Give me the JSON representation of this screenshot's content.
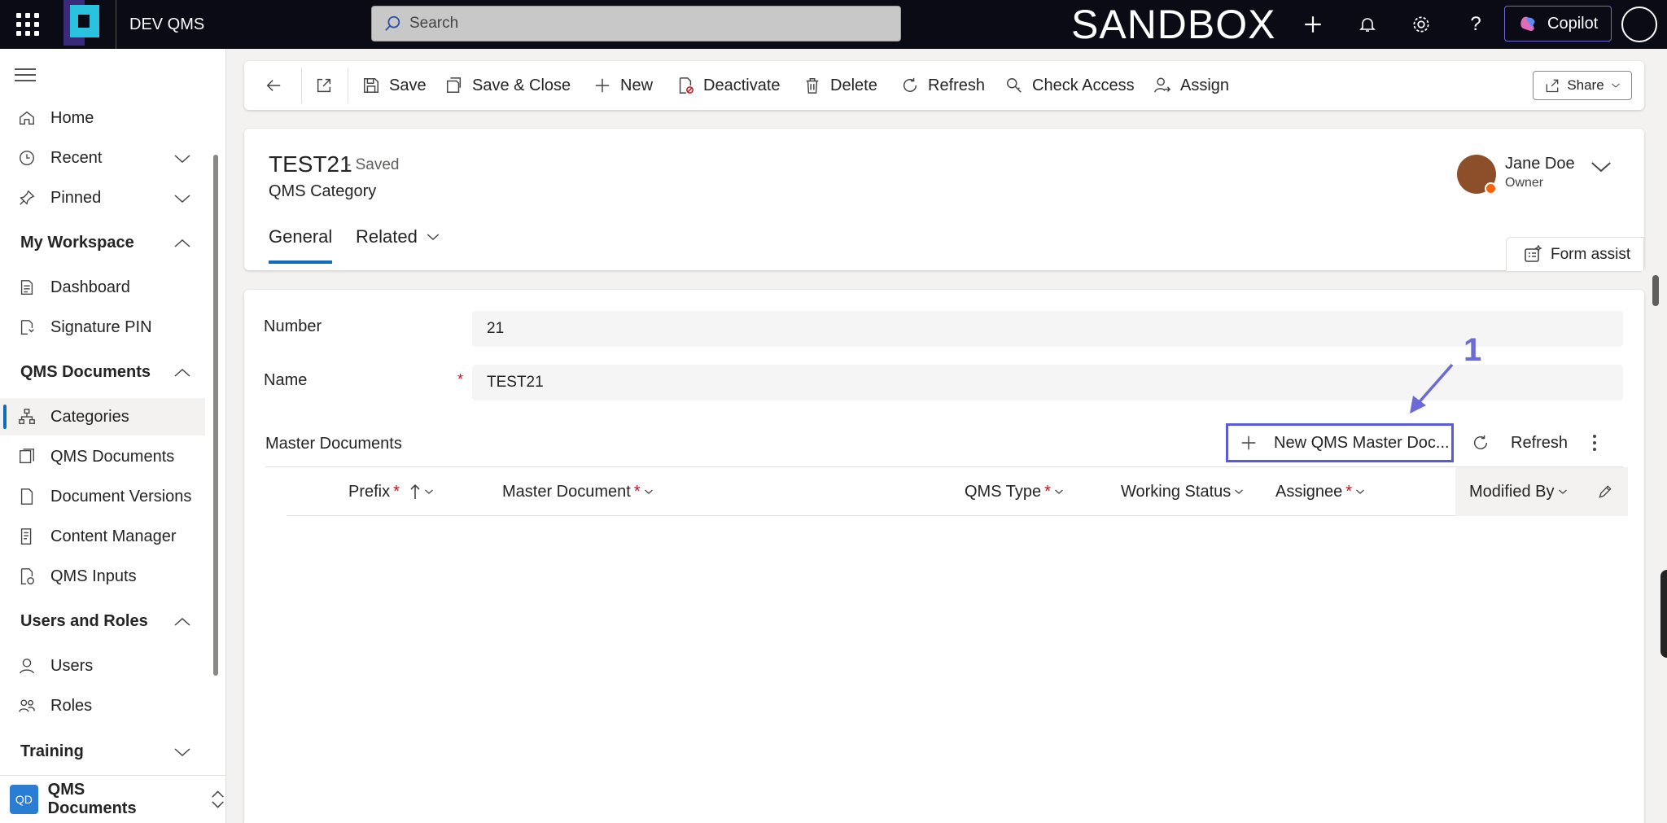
{
  "topbar": {
    "app_title": "DEV QMS",
    "search_placeholder": "Search",
    "environment_label": "SANDBOX",
    "copilot_label": "Copilot"
  },
  "sidebar": {
    "items": {
      "home": "Home",
      "recent": "Recent",
      "pinned": "Pinned",
      "dashboard": "Dashboard",
      "signature_pin": "Signature PIN",
      "categories": "Categories",
      "qms_documents": "QMS Documents",
      "document_versions": "Document Versions",
      "content_manager": "Content Manager",
      "qms_inputs": "QMS Inputs",
      "users": "Users",
      "roles": "Roles"
    },
    "groups": {
      "my_workspace": "My Workspace",
      "qms_documents": "QMS Documents",
      "users_and_roles": "Users and Roles",
      "training": "Training"
    },
    "area": {
      "badge": "QD",
      "label": "QMS Documents"
    }
  },
  "commandbar": {
    "save": "Save",
    "save_close": "Save & Close",
    "new": "New",
    "deactivate": "Deactivate",
    "delete": "Delete",
    "refresh": "Refresh",
    "check_access": "Check Access",
    "assign": "Assign",
    "share": "Share"
  },
  "record": {
    "title": "TEST21",
    "saved_status": "- Saved",
    "entity": "QMS Category",
    "tabs": {
      "general": "General",
      "related": "Related"
    },
    "owner": {
      "name": "Jane Doe",
      "role": "Owner"
    },
    "form_assist": "Form assist"
  },
  "form": {
    "number_label": "Number",
    "number_value": "21",
    "name_label": "Name",
    "name_value": "TEST21",
    "required_mark": "*"
  },
  "subgrid": {
    "title": "Master Documents",
    "new_button": "New QMS Master Doc...",
    "refresh": "Refresh",
    "columns": {
      "prefix": "Prefix",
      "master_document": "Master Document",
      "qms_type": "QMS Type",
      "working_status": "Working Status",
      "assignee": "Assignee",
      "modified_by": "Modified By"
    }
  },
  "annotation": {
    "step_number": "1"
  },
  "colors": {
    "accent": "#0f6cbd",
    "annotation": "#5b5bd6",
    "topbar": "#0b0b16",
    "required": "#c50f1f"
  }
}
